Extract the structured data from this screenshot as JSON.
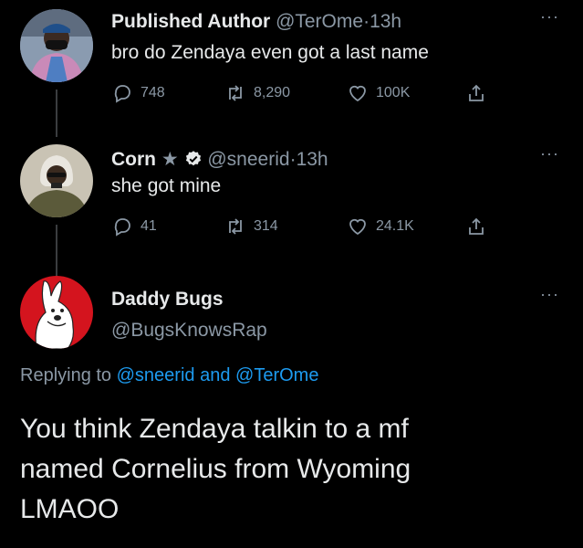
{
  "tweets": [
    {
      "name": "Published Author",
      "handle": "@TerOme",
      "time": "13h",
      "separator": "·",
      "text": "bro do Zendaya even got a last name",
      "replies": "748",
      "retweets": "8,290",
      "likes": "100K"
    },
    {
      "name": "Corn",
      "name_emoji": "★",
      "handle": "@sneerid",
      "time": "13h",
      "separator": "·",
      "text": "she got mine",
      "replies": "41",
      "retweets": "314",
      "likes": "24.1K"
    }
  ],
  "main_tweet": {
    "name": "Daddy Bugs",
    "handle": "@BugsKnowsRap",
    "replying_prefix": "Replying to",
    "reply_handle_1": "@sneerid",
    "reply_and": "and",
    "reply_handle_2": "@TerOme",
    "text": "You think Zendaya talkin to a mf\nnamed  Cornelius  from Wyoming\nLMAOO"
  },
  "more_label": "···",
  "colors": {
    "background": "#000000",
    "text": "#e7e9ea",
    "muted": "#8b98a5",
    "link": "#1d9bf0",
    "verified": "#e7e9ea"
  },
  "icons": [
    "reply-icon",
    "retweet-icon",
    "like-icon",
    "share-icon",
    "verified-icon",
    "more-icon"
  ]
}
